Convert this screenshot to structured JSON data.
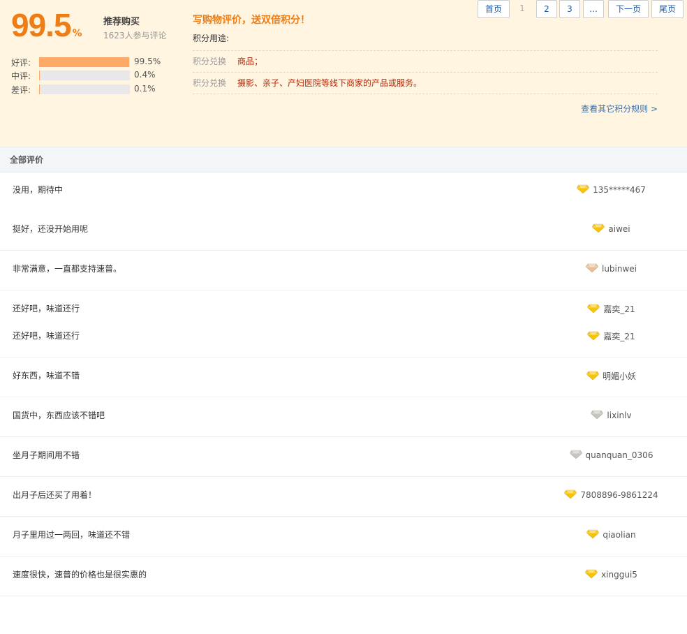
{
  "summary": {
    "score": "99.5",
    "score_unit": "%",
    "rec_title": "推荐购买",
    "participants": "1623人参与评论",
    "ratings": [
      {
        "label": "好评:",
        "value": "99.5%",
        "fraction": 0.995
      },
      {
        "label": "中评:",
        "value": "0.4%",
        "fraction": 0.004
      },
      {
        "label": "差评:",
        "value": "0.1%",
        "fraction": 0.001
      }
    ]
  },
  "points": {
    "title": "写购物评价，送双倍积分！",
    "use_label": "积分用途:",
    "rows": [
      {
        "key": "积分兑换",
        "value": "商品；"
      },
      {
        "key": "积分兑换",
        "value": "摄影、亲子、产妇医院等线下商家的产品或服务。"
      }
    ],
    "more_link": "查看其它积分规则 >"
  },
  "tab": "全部评价",
  "reviews": [
    {
      "lines": [
        {
          "text": "没用，期待中",
          "user": "135*****467",
          "gem": "gold"
        }
      ]
    },
    {
      "lines": [
        {
          "text": "挺好，还没开始用呢",
          "user": "aiwei",
          "gem": "gold"
        }
      ]
    },
    {
      "lines": [
        {
          "text": "非常满意，一直都支持速普。",
          "user": "lubinwei",
          "gem": "bronze"
        }
      ]
    },
    {
      "lines": [
        {
          "text": "还好吧，味道还行",
          "user": "嘉奕_21",
          "gem": "gold"
        },
        {
          "text": "还好吧，味道还行",
          "user": "嘉奕_21",
          "gem": "gold"
        }
      ]
    },
    {
      "lines": [
        {
          "text": "好东西，味道不错",
          "user": "明媚小妖",
          "gem": "gold"
        }
      ]
    },
    {
      "lines": [
        {
          "text": "国货中，东西应该不错吧",
          "user": "lixinlv",
          "gem": "silver"
        }
      ]
    },
    {
      "lines": [
        {
          "text": "坐月子期间用不错",
          "user": "quanquan_0306",
          "gem": "silver"
        }
      ]
    },
    {
      "lines": [
        {
          "text": "出月子后还买了用着！",
          "user": "7808896-9861224",
          "gem": "gold"
        }
      ]
    },
    {
      "lines": [
        {
          "text": "月子里用过一两回，味道还不错",
          "user": "qiaolian",
          "gem": "gold"
        }
      ]
    },
    {
      "lines": [
        {
          "text": "速度很快，速普的价格也是很实惠的",
          "user": "xinggui5",
          "gem": "gold"
        }
      ]
    }
  ],
  "pager": {
    "first": "首页",
    "current": "1",
    "pages": [
      "2",
      "3"
    ],
    "ellipsis": "...",
    "next": "下一页",
    "last": "尾页"
  },
  "colors": {
    "accent": "#ee7d15",
    "summary_bg": "#fff5e1",
    "bar_fill": "#fda968",
    "link": "#3b6fa7",
    "gem_gold": "#f8c300",
    "gem_silver": "#c4c4c4",
    "gem_bronze": "#e3c29a"
  }
}
